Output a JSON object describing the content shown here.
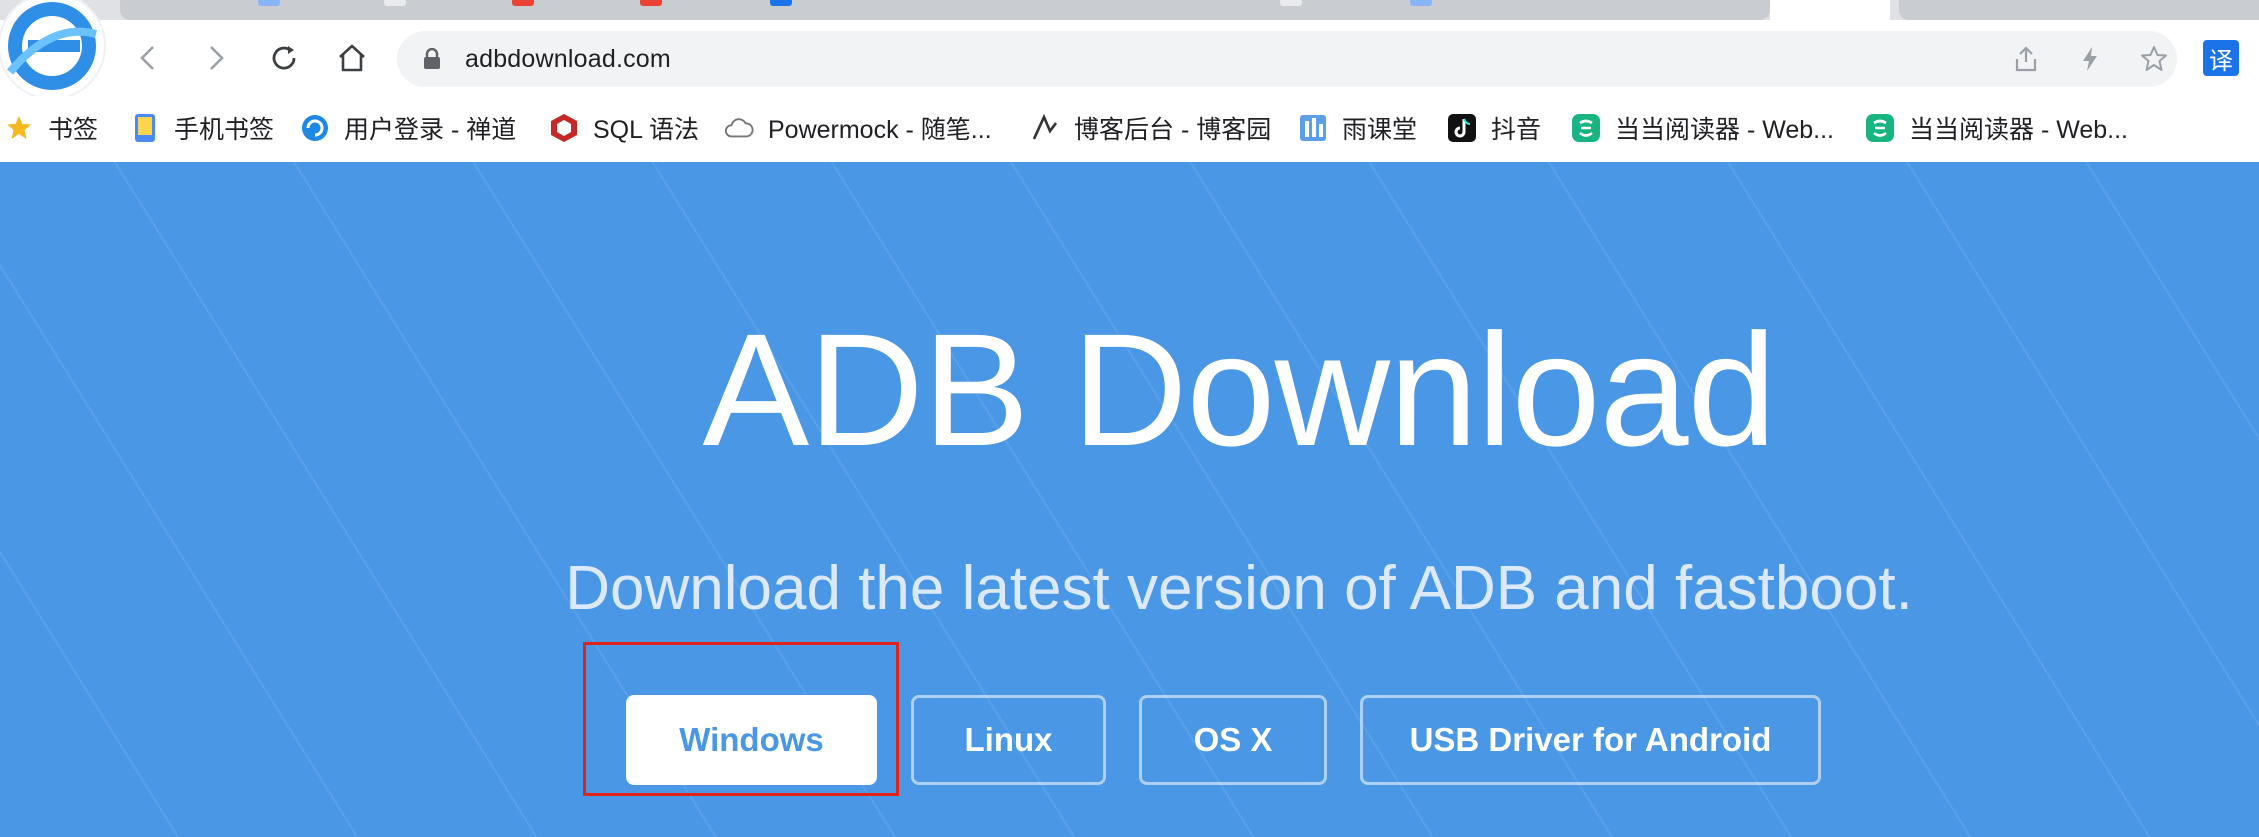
{
  "browser": {
    "url": "adbdownload.com",
    "translate_label": "译"
  },
  "bookmarks": [
    {
      "label": "书签",
      "icon": "star-icon"
    },
    {
      "label": "手机书签",
      "icon": "phone-icon"
    },
    {
      "label": "用户登录 - 禅道",
      "icon": "zentao-icon"
    },
    {
      "label": "SQL 语法",
      "icon": "sql-icon"
    },
    {
      "label": "Powermock - 随笔...",
      "icon": "cloud-icon"
    },
    {
      "label": "博客后台 - 博客园",
      "icon": "cnblogs-icon"
    },
    {
      "label": "雨课堂",
      "icon": "rain-classroom-icon"
    },
    {
      "label": "抖音",
      "icon": "douyin-icon"
    },
    {
      "label": "当当阅读器 - Web...",
      "icon": "dangdang-icon"
    },
    {
      "label": "当当阅读器 - Web...",
      "icon": "dangdang-icon"
    }
  ],
  "page": {
    "title": "ADB Download",
    "subtitle": "Download the latest version of ADB and fastboot.",
    "buttons": [
      {
        "label": "Windows",
        "selected": true
      },
      {
        "label": "Linux"
      },
      {
        "label": "OS X"
      },
      {
        "label": "USB Driver for Android"
      }
    ]
  },
  "colors": {
    "page_background": "#4a97e6",
    "highlight_border": "#e0241a",
    "primary_button_text": "#4a97e6"
  }
}
